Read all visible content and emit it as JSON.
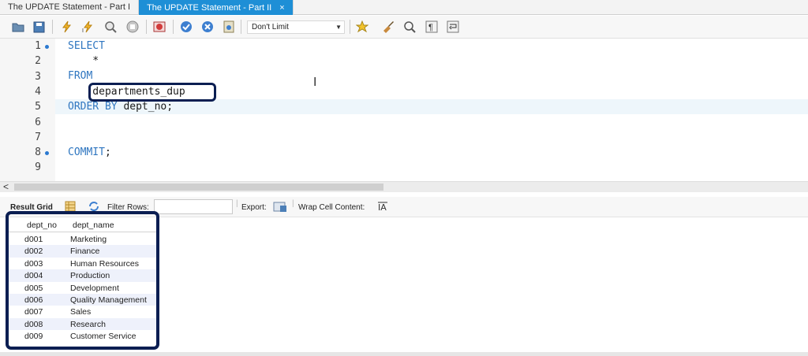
{
  "tabs": [
    {
      "label": "The UPDATE Statement - Part I"
    },
    {
      "label": "The UPDATE Statement - Part II",
      "close": "×"
    }
  ],
  "toolbar": {
    "limit_select": "Don't Limit",
    "icons": [
      "open-folder-icon",
      "save-icon",
      "execute-icon",
      "execute-current-icon",
      "explain-icon",
      "stop-icon",
      "error-toggle-icon",
      "commit-icon",
      "rollback-icon",
      "autocommit-icon",
      "beautify-icon",
      "find-icon",
      "invisible-chars-icon",
      "wrap-icon"
    ]
  },
  "editor": {
    "lines": [
      {
        "n": "1",
        "text": "SELECT",
        "kind": "kw",
        "marker": true
      },
      {
        "n": "2",
        "text": "    *",
        "kind": "id",
        "marker": false
      },
      {
        "n": "3",
        "text": "FROM",
        "kind": "kw",
        "marker": false
      },
      {
        "n": "4",
        "text": "    departments_dup",
        "kind": "id",
        "marker": false
      },
      {
        "n": "5",
        "text_kw": "ORDER BY",
        "text_id": " dept_no;",
        "marker": false
      },
      {
        "n": "6",
        "text": "",
        "marker": false
      },
      {
        "n": "7",
        "text": "",
        "marker": false
      },
      {
        "n": "8",
        "text_kw": "COMMIT",
        "text_id": ";",
        "marker": true
      },
      {
        "n": "9",
        "text": "",
        "marker": false
      }
    ]
  },
  "results": {
    "result_grid_label": "Result Grid",
    "filter_rows_label": "Filter Rows:",
    "filter_value": "",
    "export_label": "Export:",
    "wrap_label": "Wrap Cell Content:",
    "columns": [
      "dept_no",
      "dept_name"
    ],
    "rows": [
      [
        "d001",
        "Marketing"
      ],
      [
        "d002",
        "Finance"
      ],
      [
        "d003",
        "Human Resources"
      ],
      [
        "d004",
        "Production"
      ],
      [
        "d005",
        "Development"
      ],
      [
        "d006",
        "Quality Management"
      ],
      [
        "d007",
        "Sales"
      ],
      [
        "d008",
        "Research"
      ],
      [
        "d009",
        "Customer Service"
      ]
    ]
  }
}
